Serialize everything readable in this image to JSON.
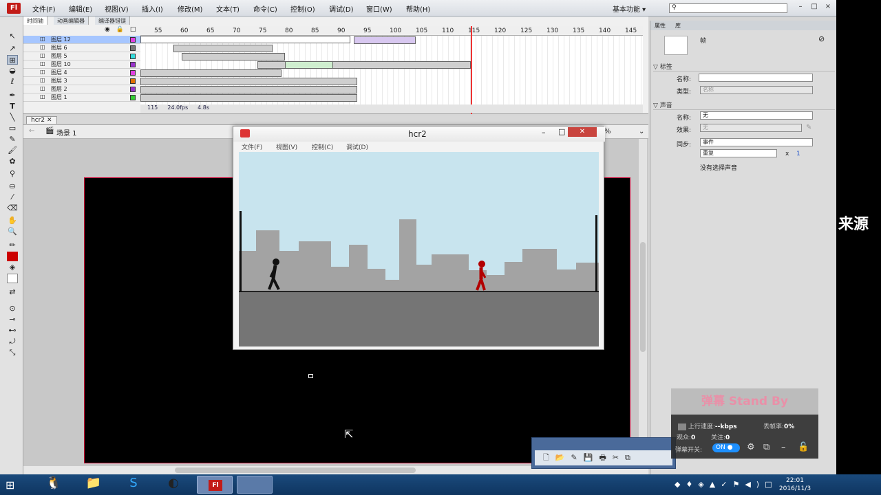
{
  "app": {
    "logo": "Fl",
    "menus": [
      "文件(F)",
      "编辑(E)",
      "视图(V)",
      "插入(I)",
      "修改(M)",
      "文本(T)",
      "命令(C)",
      "控制(O)",
      "调试(D)",
      "窗口(W)",
      "帮助(H)"
    ],
    "workspace": "基本功能",
    "search_placeholder": "",
    "window_controls": [
      "–",
      "□",
      "×"
    ]
  },
  "timeline": {
    "tabs": [
      "时间轴",
      "动画编辑器",
      "编译器错误"
    ],
    "ruler_ticks": [
      "55",
      "60",
      "65",
      "70",
      "75",
      "80",
      "85",
      "90",
      "95",
      "100",
      "105",
      "110",
      "115",
      "120",
      "125",
      "130",
      "135",
      "140",
      "145"
    ],
    "playhead_frame": "115",
    "layers": [
      {
        "name": "图层 12",
        "color": "#e040e0",
        "selected": true
      },
      {
        "name": "图层 6",
        "color": "#777777",
        "selected": false
      },
      {
        "name": "图层 5",
        "color": "#33dddd",
        "selected": false
      },
      {
        "name": "图层 10",
        "color": "#9933cc",
        "selected": false
      },
      {
        "name": "图层 4",
        "color": "#e040e0",
        "selected": false
      },
      {
        "name": "图层 3",
        "color": "#e07000",
        "selected": false
      },
      {
        "name": "图层 2",
        "color": "#9933cc",
        "selected": false
      },
      {
        "name": "图层 1",
        "color": "#33cc33",
        "selected": false
      }
    ],
    "footer": {
      "frame": "115",
      "fps": "24.0fps",
      "time": "4.8s"
    }
  },
  "document": {
    "tab": "hcr2",
    "scene": "场景 1",
    "zoom": "%"
  },
  "properties": {
    "tabs": [
      "属性",
      "库"
    ],
    "frame_label": "帧",
    "section_label": "标签",
    "name_label": "名称:",
    "type_label": "类型:",
    "type_value": "名称",
    "section_sound": "声音",
    "sound_name_label": "名称:",
    "sound_name_value": "无",
    "effect_label": "效果:",
    "effect_value": "无",
    "sync_label": "同步:",
    "sync_value": "事件",
    "repeat_value": "重复",
    "repeat_count_x": "x",
    "repeat_count": "1",
    "no_sound": "没有选择声音"
  },
  "player": {
    "title": "hcr2",
    "menus": [
      "文件(F)",
      "视图(V)",
      "控制(C)",
      "调试(D)"
    ]
  },
  "danmu": {
    "header": "弹幕 Stand By",
    "upload_label": "上行速度:",
    "upload_value": "--kbps",
    "drop_label": "丢帧率:",
    "drop_value": "0%",
    "viewers_label": "观众:",
    "viewers_value": "0",
    "follow_label": "关注:",
    "follow_value": "0",
    "switch_label": "弹幕开关:",
    "switch_value": "ON"
  },
  "side_text": "来源",
  "taskbar": {
    "time": "22:01",
    "date": "2016/11/3"
  }
}
